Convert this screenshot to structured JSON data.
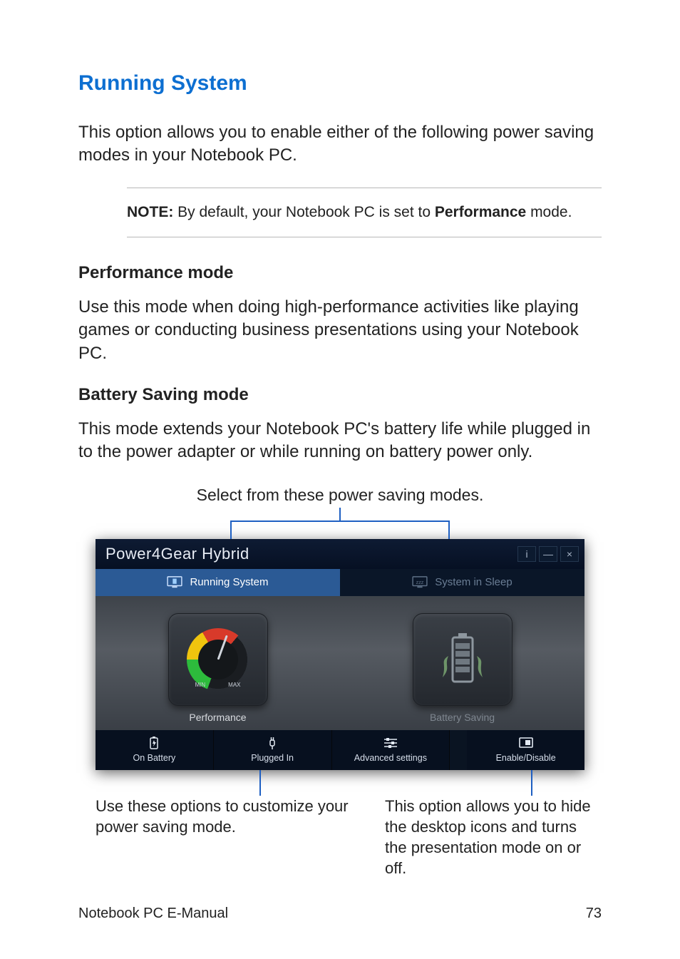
{
  "heading": "Running System",
  "intro": "This option allows you to enable either of the following power saving modes in your Notebook PC.",
  "note": {
    "label": "NOTE:",
    "text_a": " By default, your Notebook PC is set to ",
    "strong": "Performance",
    "text_b": " mode."
  },
  "perf": {
    "title": "Performance mode",
    "body": "Use this mode when doing high-performance activities like playing games or conducting business presentations using your Notebook PC."
  },
  "batt": {
    "title": "Battery Saving mode",
    "body": "This mode extends your Notebook PC's battery life while plugged in to the power adapter or while running on battery power only."
  },
  "callout_top": "Select from these power saving modes.",
  "app": {
    "title": "Power4Gear Hybrid",
    "tabs": {
      "running": "Running System",
      "sleep": "System in Sleep"
    },
    "modes": {
      "performance": "Performance",
      "battery": "Battery Saving"
    },
    "gauge": {
      "min": "MIN",
      "max": "MAX"
    },
    "toolbar": {
      "on_battery": "On Battery",
      "plugged_in": "Plugged In",
      "advanced": "Advanced settings",
      "enable_disable": "Enable/Disable"
    }
  },
  "annot_left": "Use these options to customize your power saving mode.",
  "annot_right": "This option allows you to hide the desktop icons and turns the presentation mode on or off.",
  "footer": {
    "title": "Notebook PC E-Manual",
    "page": "73"
  }
}
